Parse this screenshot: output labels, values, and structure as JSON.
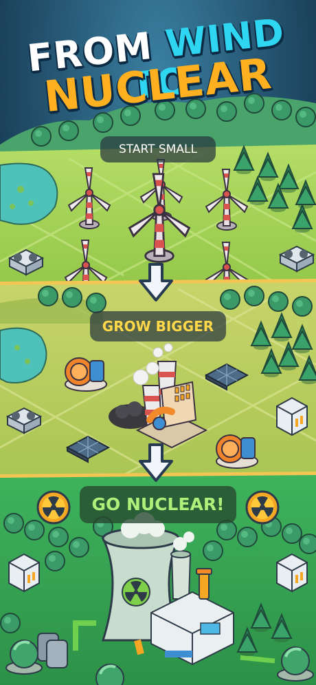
{
  "headline": {
    "line1_word1": "FROM",
    "line1_word2": "WIND TO",
    "line2": "NUCLEAR"
  },
  "stages": [
    {
      "label": "START SMALL"
    },
    {
      "label": "GROW BIGGER"
    },
    {
      "label": "GO NUCLEAR!"
    }
  ],
  "icons": {
    "arrow": "arrow-down-icon",
    "radiation": "radiation-icon"
  },
  "colors": {
    "title_white": "#ffffff",
    "title_cyan": "#2fd6f2",
    "title_orange": "#ffb020",
    "stage2_label": "#ffd84a",
    "stage3_label": "#aef07a",
    "grass": "#a8d65a",
    "sky": "#1a3a52"
  }
}
